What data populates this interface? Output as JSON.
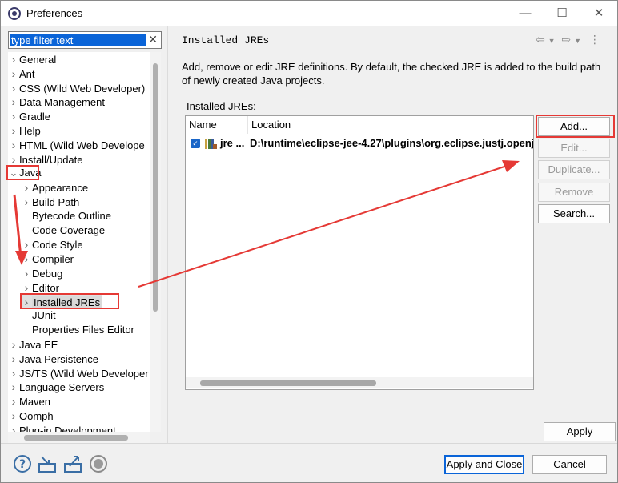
{
  "window": {
    "title": "Preferences",
    "controls": [
      "minimize-icon",
      "maximize-icon",
      "close-icon"
    ]
  },
  "filter": {
    "placeholder": "type filter text"
  },
  "tree": {
    "items": [
      {
        "label": "General",
        "level": 0,
        "expander": "collapsed"
      },
      {
        "label": "Ant",
        "level": 0,
        "expander": "collapsed"
      },
      {
        "label": "CSS (Wild Web Developer)",
        "level": 0,
        "expander": "collapsed"
      },
      {
        "label": "Data Management",
        "level": 0,
        "expander": "collapsed"
      },
      {
        "label": "Gradle",
        "level": 0,
        "expander": "collapsed"
      },
      {
        "label": "Help",
        "level": 0,
        "expander": "collapsed"
      },
      {
        "label": "HTML (Wild Web Develope",
        "level": 0,
        "expander": "collapsed"
      },
      {
        "label": "Install/Update",
        "level": 0,
        "expander": "collapsed"
      },
      {
        "label": "Java",
        "level": 0,
        "expander": "expanded"
      },
      {
        "label": "Appearance",
        "level": 1,
        "expander": "collapsed"
      },
      {
        "label": "Build Path",
        "level": 1,
        "expander": "collapsed"
      },
      {
        "label": "Bytecode Outline",
        "level": 1,
        "expander": "none"
      },
      {
        "label": "Code Coverage",
        "level": 1,
        "expander": "none"
      },
      {
        "label": "Code Style",
        "level": 1,
        "expander": "collapsed"
      },
      {
        "label": "Compiler",
        "level": 1,
        "expander": "collapsed"
      },
      {
        "label": "Debug",
        "level": 1,
        "expander": "collapsed"
      },
      {
        "label": "Editor",
        "level": 1,
        "expander": "collapsed"
      },
      {
        "label": "Installed JREs",
        "level": 1,
        "expander": "collapsed",
        "selected": true
      },
      {
        "label": "JUnit",
        "level": 1,
        "expander": "none"
      },
      {
        "label": "Properties Files Editor",
        "level": 1,
        "expander": "none"
      },
      {
        "label": "Java EE",
        "level": 0,
        "expander": "collapsed"
      },
      {
        "label": "Java Persistence",
        "level": 0,
        "expander": "collapsed"
      },
      {
        "label": "JS/TS (Wild Web Developer",
        "level": 0,
        "expander": "collapsed"
      },
      {
        "label": "Language Servers",
        "level": 0,
        "expander": "collapsed"
      },
      {
        "label": "Maven",
        "level": 0,
        "expander": "collapsed"
      },
      {
        "label": "Oomph",
        "level": 0,
        "expander": "collapsed"
      },
      {
        "label": "Plug-in Development",
        "level": 0,
        "expander": "collapsed"
      }
    ]
  },
  "page": {
    "title": "Installed JREs",
    "description": "Add, remove or edit JRE definitions. By default, the checked JRE is added to the build path of newly created Java projects.",
    "list_label": "Installed JREs:",
    "nav_icons": [
      "back-arrow-icon",
      "forward-arrow-icon",
      "menu-icon"
    ]
  },
  "table": {
    "columns": [
      "Name",
      "Location"
    ],
    "rows": [
      {
        "checked": true,
        "name": "jre ...",
        "location": "D:\\runtime\\eclipse-jee-4.27\\plugins\\org.eclipse.justj.openj"
      }
    ]
  },
  "buttons": {
    "add": "Add...",
    "edit": "Edit...",
    "duplicate": "Duplicate...",
    "remove": "Remove",
    "search": "Search...",
    "apply": "Apply",
    "apply_close": "Apply and Close",
    "cancel": "Cancel"
  },
  "bottom_icons": [
    "help-icon",
    "import-icon",
    "export-icon",
    "record-icon"
  ],
  "colors": {
    "annotation": "#e53935",
    "selection": "#0a64d8"
  }
}
